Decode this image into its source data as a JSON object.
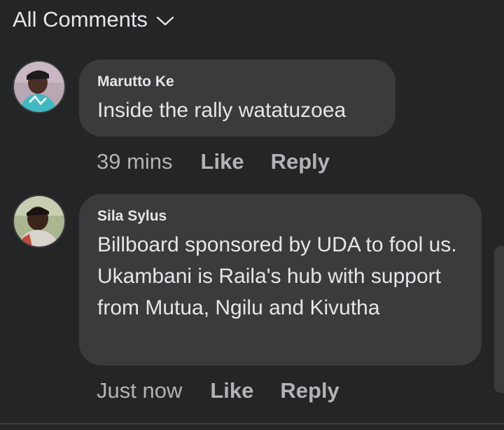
{
  "header": {
    "label": "All Comments",
    "chevron_icon": "chevron-down-icon"
  },
  "comments": [
    {
      "author": "Marutto Ke",
      "text": "Inside the rally watatuzoea",
      "time": "39 mins",
      "like_label": "Like",
      "reply_label": "Reply"
    },
    {
      "author": "Sila Sylus",
      "text": "Billboard sponsored by UDA to fool us. Ukambani is Raila's hub with support from Mutua, Ngilu and Kivutha",
      "time": "Just now",
      "like_label": "Like",
      "reply_label": "Reply"
    }
  ],
  "colors": {
    "background": "#242526",
    "bubble": "#3a3b3c",
    "primary_text": "#e4e6eb",
    "secondary_text": "#b0b3b8"
  }
}
